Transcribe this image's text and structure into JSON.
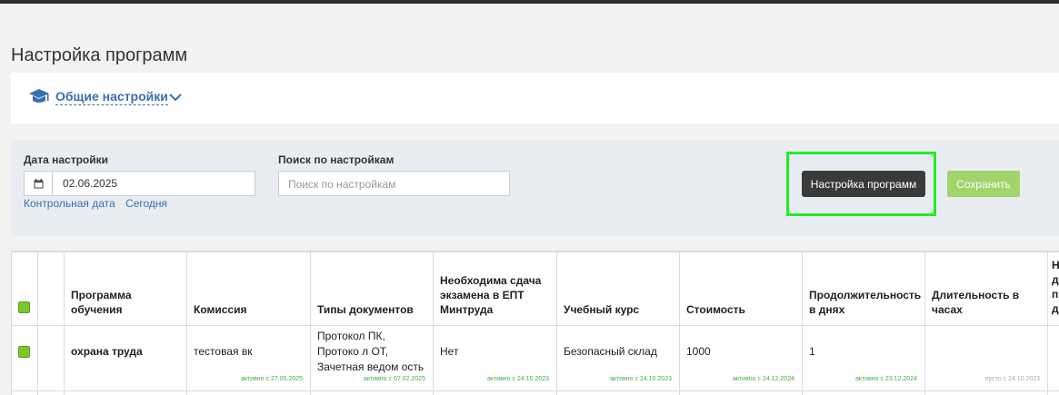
{
  "page": {
    "title": "Настройка программ"
  },
  "general": {
    "label": "Общие настройки",
    "icon": "graduation-cap-icon",
    "expand_icon": "chevron-down-icon"
  },
  "filters": {
    "date_label": "Дата настройки",
    "date_value": "02.06.2025",
    "control_date_link": "Контрольная дата",
    "today_link": "Сегодня",
    "search_label": "Поиск по настройкам",
    "search_placeholder": "Поиск по настройкам"
  },
  "actions": {
    "programs_button": "Настройка программ",
    "save_button": "Сохранить"
  },
  "colors": {
    "accent": "#3a6fb0",
    "save": "#9fd56a",
    "highlight": "#22ee22",
    "checkbox": "#7cc62f",
    "note": "#4aa84a"
  },
  "table": {
    "headers": [
      "",
      "",
      "Программа обучения",
      "Комиссия",
      "Типы документов",
      "Необходима сдача экзамена в ЕПТ Минтруда",
      "Учебный курс",
      "Стоимость",
      "Продолжительность в днях",
      "Длительность в часах",
      "Н\nд\nп\nд"
    ],
    "rows": [
      {
        "program": "охрана труда",
        "commission": "тестовая вк",
        "commission_note": "активно с 27.05.2025",
        "doc_types": "Протокол ПК, Протоко л ОТ, Зачетная ведом ость",
        "doc_types_note": "активно с 07.02.2025",
        "exam": "Нет",
        "exam_note": "активно с 24.10.2023",
        "course": "Безопасный склад",
        "course_note": "активно с 24.10.2023",
        "cost": "1000",
        "cost_note": "активно с 24.12.2024",
        "days": "1",
        "days_note": "активно с 23.12.2024",
        "hours": "",
        "hours_note": "пусто с 24.10.2023"
      }
    ]
  }
}
